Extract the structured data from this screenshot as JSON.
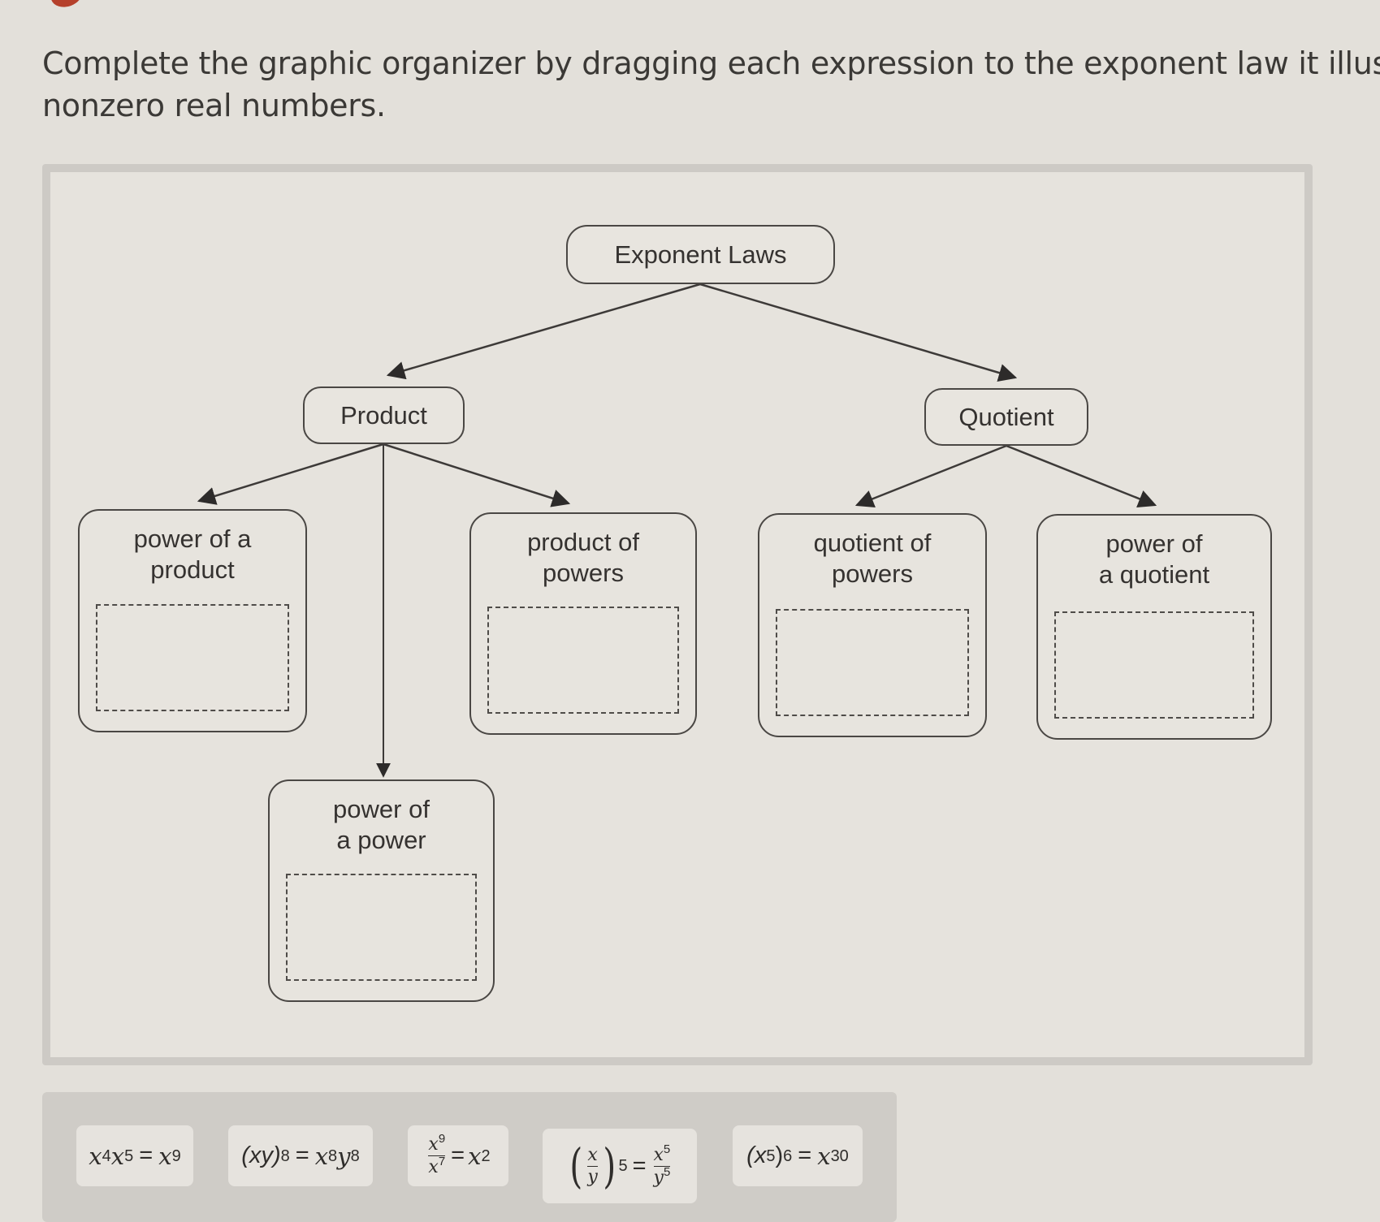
{
  "instructions": {
    "line1": "Complete the graphic organizer by dragging each expression to the exponent law it illustrat",
    "line2": "nonzero real numbers."
  },
  "organizer": {
    "root": "Exponent Laws",
    "branches": [
      {
        "label": "Product",
        "children": [
          {
            "id": "power-of-a-product",
            "line1": "power of a",
            "line2": "product",
            "drop_value": ""
          },
          {
            "id": "power-of-a-power",
            "line1": "power of",
            "line2": "a power",
            "drop_value": ""
          },
          {
            "id": "product-of-powers",
            "line1": "product of",
            "line2": "powers",
            "drop_value": ""
          }
        ]
      },
      {
        "label": "Quotient",
        "children": [
          {
            "id": "quotient-of-powers",
            "line1": "quotient of",
            "line2": "powers",
            "drop_value": ""
          },
          {
            "id": "power-of-a-quotient",
            "line1": "power of",
            "line2": "a quotient",
            "drop_value": ""
          }
        ]
      }
    ]
  },
  "tray": {
    "expressions": [
      {
        "id": "expr-1",
        "text": "x^4 x^5 = x^9",
        "base1": "x",
        "exp1": "4",
        "base2": "x",
        "exp2": "5",
        "eq": "=",
        "rbase": "x",
        "rexp": "9"
      },
      {
        "id": "expr-2",
        "text": "(xy)^8 = x^8 y^8",
        "lhs": "(xy)",
        "lexp": "8",
        "eq": "=",
        "r1": "x",
        "r1exp": "8",
        "r2": "y",
        "r2exp": "8"
      },
      {
        "id": "expr-3",
        "text": "x^9 / x^7 = x^2",
        "num": "x",
        "numexp": "9",
        "den": "x",
        "denexp": "7",
        "eq": "=",
        "rbase": "x",
        "rexp": "2"
      },
      {
        "id": "expr-4",
        "text": "(x/y)^5 = x^5 / y^5",
        "num": "x",
        "den": "y",
        "outexp": "5",
        "eq": "=",
        "rnum": "x",
        "rnumexp": "5",
        "rden": "y",
        "rdenexp": "5"
      },
      {
        "id": "expr-5",
        "text": "(x^5)^6 = x^30",
        "open": "(x",
        "inexp": "5",
        "close": ")",
        "outexp": "6",
        "eq": "=",
        "rbase": "x",
        "rexp": "30"
      }
    ]
  },
  "colors": {
    "background": "#e3e0da",
    "frame_border": "#cdcac5",
    "node_border": "#4a4744",
    "tray": "#cfccc7",
    "tile": "#e6e3de",
    "text": "#353230"
  }
}
